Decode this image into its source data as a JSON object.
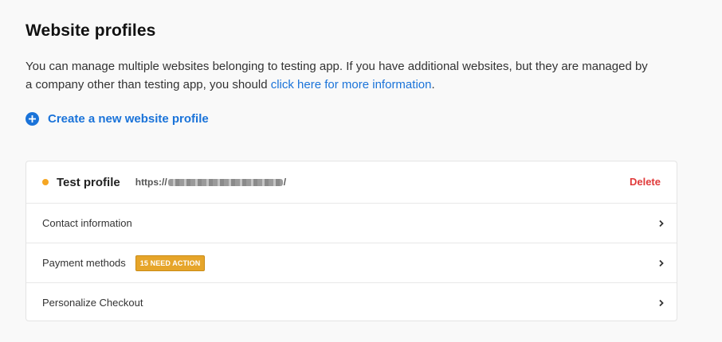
{
  "page": {
    "title": "Website profiles",
    "intro_text": "You can manage multiple websites belonging to testing app. If you have additional websites, but they are managed by a company other than testing app, you should ",
    "intro_link": "click here for more information",
    "intro_end": ".",
    "create_label": "Create a new website profile"
  },
  "profile": {
    "name": "Test profile",
    "url_prefix": "https://",
    "url_suffix": "/",
    "delete_label": "Delete",
    "status_color": "#f5a623"
  },
  "rows": [
    {
      "label": "Contact information",
      "badge": ""
    },
    {
      "label": "Payment methods",
      "badge": "15 NEED ACTION"
    },
    {
      "label": "Personalize Checkout",
      "badge": ""
    }
  ],
  "colors": {
    "accent": "#1a73d9",
    "danger": "#e03a3a",
    "warning": "#e6a52a"
  },
  "icons": {
    "create": "plus-circle-icon",
    "row_arrow": "chevron-right-icon"
  }
}
